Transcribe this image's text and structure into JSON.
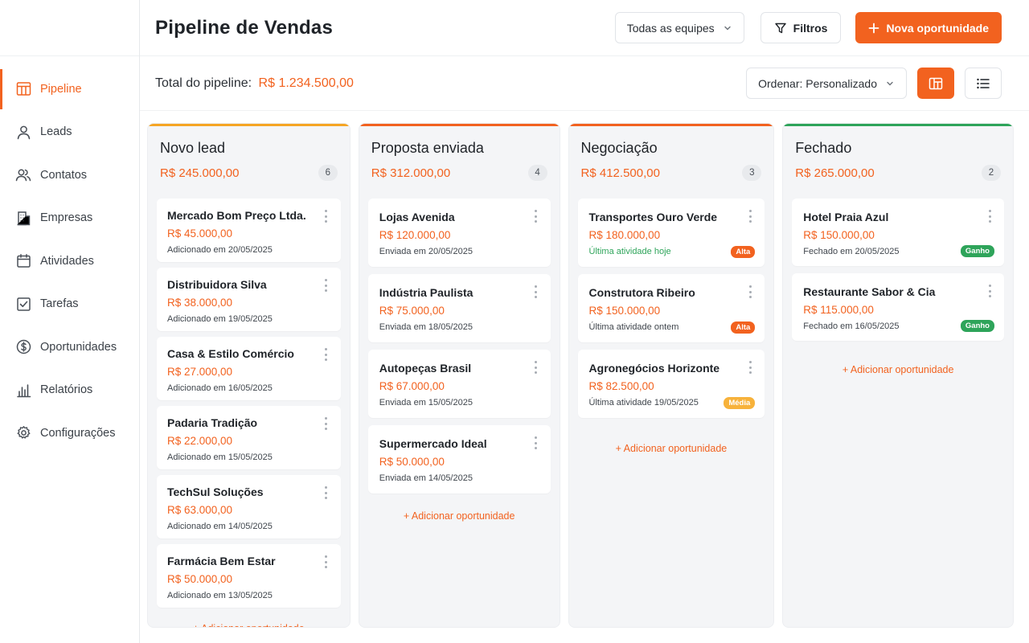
{
  "sidebar": {
    "items": [
      {
        "label": "Pipeline",
        "icon": "pipeline-icon",
        "active": true
      },
      {
        "label": "Leads",
        "icon": "user-icon",
        "active": false
      },
      {
        "label": "Contatos",
        "icon": "users-icon",
        "active": false
      },
      {
        "label": "Empresas",
        "icon": "building-icon",
        "active": false
      },
      {
        "label": "Atividades",
        "icon": "calendar-icon",
        "active": false
      },
      {
        "label": "Tarefas",
        "icon": "checkbox-icon",
        "active": false
      },
      {
        "label": "Oportunidades",
        "icon": "dollar-icon",
        "active": false
      },
      {
        "label": "Relatórios",
        "icon": "bar-chart-icon",
        "active": false
      },
      {
        "label": "Configurações",
        "icon": "gear-icon",
        "active": false
      }
    ]
  },
  "header": {
    "title": "Pipeline de Vendas",
    "team_select": "Todas as equipes",
    "filters_label": "Filtros",
    "new_label": "Nova oportunidade"
  },
  "subbar": {
    "total_label": "Total do pipeline:",
    "total_value": "R$ 1.234.500,00",
    "sort_label": "Ordenar: Personalizado"
  },
  "colors": {
    "accent": "#f2621f",
    "novo_lead": "#f5a524",
    "proposta": "#f2621f",
    "negociacao": "#f2621f",
    "fechado": "#2ea45a"
  },
  "columns": [
    {
      "title": "Novo lead",
      "amount": "R$ 245.000,00",
      "count": "6",
      "accent": "novo_lead",
      "cards": [
        {
          "name": "Mercado Bom Preço Ltda.",
          "value": "R$ 45.000,00",
          "sub": "Adicionado em 20/05/2025"
        },
        {
          "name": "Distribuidora Silva",
          "value": "R$ 38.000,00",
          "sub": "Adicionado em 19/05/2025"
        },
        {
          "name": "Casa & Estilo Comércio",
          "value": "R$ 27.000,00",
          "sub": "Adicionado em 16/05/2025"
        },
        {
          "name": "Padaria Tradição",
          "value": "R$ 22.000,00",
          "sub": "Adicionado em 15/05/2025"
        },
        {
          "name": "TechSul Soluções",
          "value": "R$ 63.000,00",
          "sub": "Adicionado em 14/05/2025"
        },
        {
          "name": "Farmácia Bem Estar",
          "value": "R$ 50.000,00",
          "sub": "Adicionado em 13/05/2025"
        }
      ],
      "add_label": "+ Adicionar oportunidade"
    },
    {
      "title": "Proposta enviada",
      "amount": "R$ 312.000,00",
      "count": "4",
      "accent": "proposta",
      "cards": [
        {
          "name": "Lojas Avenida",
          "value": "R$ 120.000,00",
          "sub": "Enviada em 20/05/2025"
        },
        {
          "name": "Indústria Paulista",
          "value": "R$ 75.000,00",
          "sub": "Enviada em 18/05/2025"
        },
        {
          "name": "Autopeças Brasil",
          "value": "R$ 67.000,00",
          "sub": "Enviada em 15/05/2025"
        },
        {
          "name": "Supermercado Ideal",
          "value": "R$ 50.000,00",
          "sub": "Enviada em 14/05/2025"
        }
      ],
      "add_label": "+ Adicionar oportunidade"
    },
    {
      "title": "Negociação",
      "amount": "R$ 412.500,00",
      "count": "3",
      "accent": "negociacao",
      "cards": [
        {
          "name": "Transportes Ouro Verde",
          "value": "R$ 180.000,00",
          "sub": "Última atividade hoje",
          "sub_green": true,
          "badge": "Alta",
          "badge_color": "#f2621f"
        },
        {
          "name": "Construtora Ribeiro",
          "value": "R$ 150.000,00",
          "sub": "Última atividade ontem",
          "badge": "Alta",
          "badge_color": "#f2621f"
        },
        {
          "name": "Agronegócios Horizonte",
          "value": "R$ 82.500,00",
          "sub": "Última atividade 19/05/2025",
          "badge": "Média",
          "badge_color": "#f7b23b"
        }
      ],
      "add_label": "+ Adicionar oportunidade"
    },
    {
      "title": "Fechado",
      "amount": "R$ 265.000,00",
      "count": "2",
      "accent": "fechado",
      "cards": [
        {
          "name": "Hotel Praia Azul",
          "value": "R$ 150.000,00",
          "sub": "Fechado em 20/05/2025",
          "badge": "Ganho",
          "badge_color": "#2ea45a"
        },
        {
          "name": "Restaurante Sabor & Cia",
          "value": "R$ 115.000,00",
          "sub": "Fechado em 16/05/2025",
          "badge": "Ganho",
          "badge_color": "#2ea45a"
        }
      ],
      "add_label": "+ Adicionar oportunidade"
    }
  ]
}
